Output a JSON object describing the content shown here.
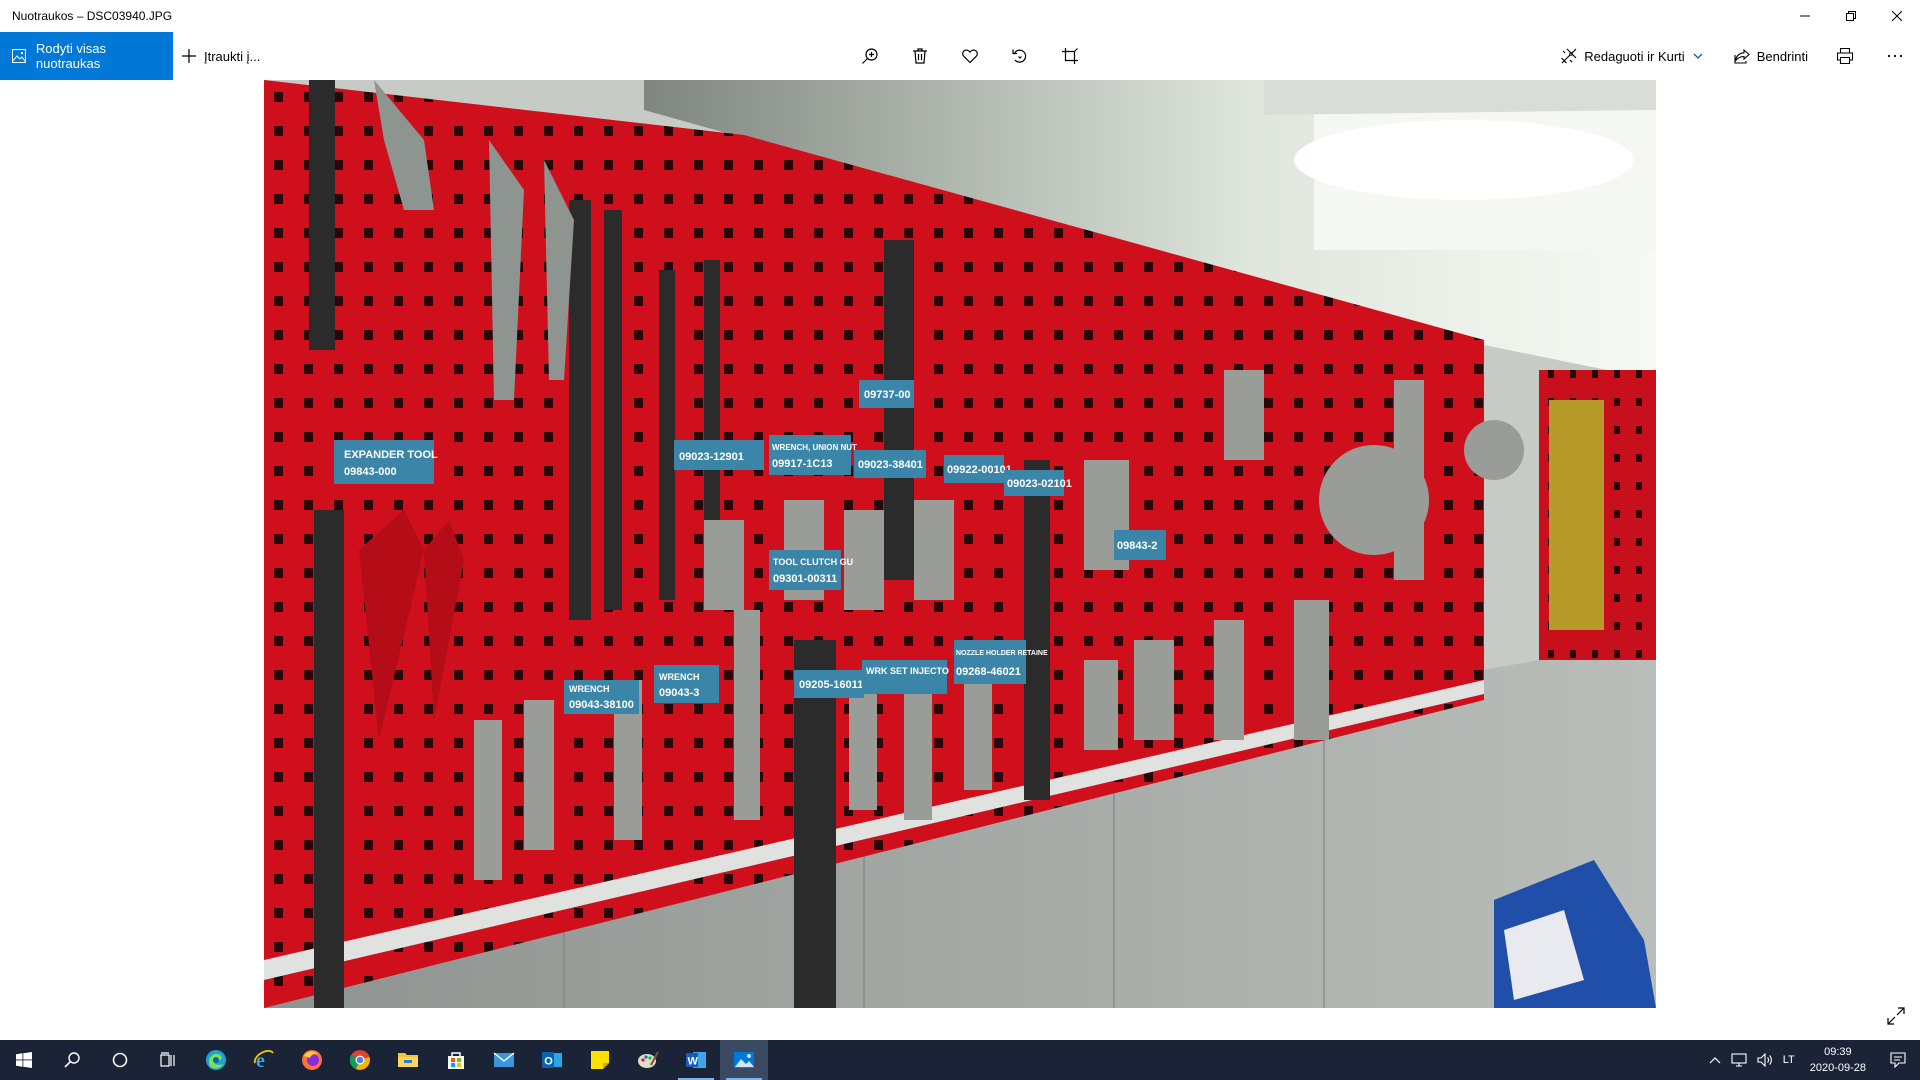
{
  "window": {
    "title": "Nuotraukos – DSC03940.JPG",
    "minimize_icon": "minimize-icon",
    "maximize_icon": "restore-icon",
    "close_icon": "close-icon"
  },
  "toolbar": {
    "show_all_label": "Rodyti visas nuotraukas",
    "add_to_label": "Įtraukti į...",
    "edit_label": "Redaguoti ir Kurti",
    "share_label": "Bendrinti",
    "center_icons": [
      "zoom-in-icon",
      "delete-icon",
      "favorite-icon",
      "rotate-icon",
      "crop-icon"
    ],
    "accent_color": "#0078d7"
  },
  "photo": {
    "panel_labels": [
      "09023-12901",
      "09043-38100",
      "09043-3",
      "09205-16011",
      "09023-38401",
      "09301-00311",
      "WRENCH",
      "WRENCH",
      "WRENCH, UNION NUT",
      "09917-1C13",
      "09737-00",
      "09922-00101",
      "09023-02101",
      "WRK SET INJECTO",
      "NOZZLE HOLDER RETAINE",
      "09268-46021",
      "TOOL CLUTCH GU",
      "EXPANDER TOOL",
      "09843-2",
      "09843-000"
    ]
  },
  "taskbar": {
    "apps": [
      {
        "name": "start-icon"
      },
      {
        "name": "search-icon"
      },
      {
        "name": "cortana-icon"
      },
      {
        "name": "task-view-icon"
      },
      {
        "name": "edge-chromium-icon"
      },
      {
        "name": "internet-explorer-icon"
      },
      {
        "name": "firefox-icon"
      },
      {
        "name": "chrome-icon"
      },
      {
        "name": "file-explorer-icon"
      },
      {
        "name": "store-icon"
      },
      {
        "name": "mail-icon"
      },
      {
        "name": "outlook-icon"
      },
      {
        "name": "sticky-notes-icon"
      },
      {
        "name": "paint-icon"
      },
      {
        "name": "word-icon"
      },
      {
        "name": "photos-icon"
      }
    ],
    "language": "LT",
    "time": "09:39",
    "date": "2020-09-28"
  }
}
